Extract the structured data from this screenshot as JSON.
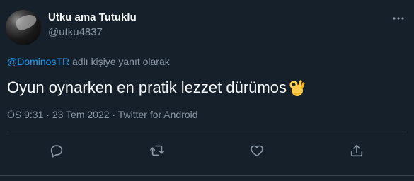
{
  "tweet": {
    "author_name": "Utku ama Tutuklu",
    "author_handle": "@utku4837",
    "reply_mention": "@DominosTR",
    "reply_suffix": " adlı kişiye yanıt olarak",
    "text": "Oyun oynarken en pratik lezzet dürümos",
    "emoji": "ok-hand-emoji",
    "time": "ÖS 9:31",
    "date": "23 Tem 2022",
    "source": "Twitter for Android"
  },
  "icons": {
    "more": "more-dots-icon",
    "reply": "reply-icon",
    "retweet": "retweet-icon",
    "like": "like-icon",
    "share": "share-icon"
  },
  "colors": {
    "background": "#15202b",
    "text": "#f7f9f9",
    "muted": "#8b98a5",
    "link": "#1d9bf0",
    "divider": "#38444d"
  }
}
